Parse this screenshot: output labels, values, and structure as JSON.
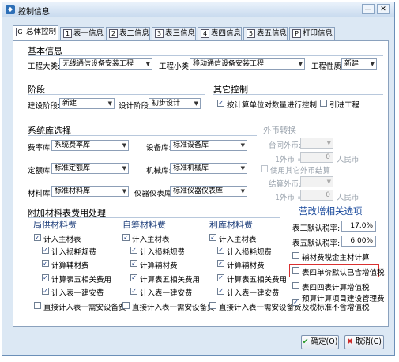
{
  "window": {
    "title": "控制信息",
    "min": "—",
    "close": "✕"
  },
  "tabs": [
    {
      "icon": "G",
      "label": "总体控制"
    },
    {
      "icon": "1",
      "label": "表一信息"
    },
    {
      "icon": "2",
      "label": "表二信息"
    },
    {
      "icon": "3",
      "label": "表三信息"
    },
    {
      "icon": "4",
      "label": "表四信息"
    },
    {
      "icon": "5",
      "label": "表五信息"
    },
    {
      "icon": "P",
      "label": "打印信息"
    }
  ],
  "basic": {
    "title": "基本信息",
    "project_category_label": "工程大类:",
    "project_category_value": "无线通信设备安装工程",
    "project_subcategory_label": "工程小类:",
    "project_subcategory_value": "移动通信设备安装工程",
    "project_nature_label": "工程性质:",
    "project_nature_value": "新建"
  },
  "stage": {
    "title": "阶段",
    "build_stage_label": "建设阶段:",
    "build_stage_value": "新建",
    "design_stage_label": "设计阶段:",
    "design_stage_value": "初步设计"
  },
  "other": {
    "title": "其它控制",
    "cb_mgmt": "按计算单位对数量进行控制",
    "cb_mgmt_checked": true,
    "cb_intro": "引进工程",
    "cb_intro_checked": false
  },
  "library": {
    "title": "系统库选择",
    "fee_label": "费率库:",
    "fee_value": "系统费率库",
    "equip_label": "设备库:",
    "equip_value": "标准设备库",
    "quota_label": "定额库:",
    "quota_value": "标准定额库",
    "machine_label": "机械库:",
    "machine_value": "标准机械库",
    "material_label": "材料库:",
    "material_value": "标准材料库",
    "meter_label": "仪器仪表库:",
    "meter_value": "标准仪器仪表库"
  },
  "foreign": {
    "title": "外币转换",
    "cb_label": "使用其它外币结算",
    "row1_label": "台同外币:",
    "row2_prefix": "1外币 =",
    "row2_value": "0",
    "row2_unit": "人民币",
    "row3_label": "结算外币:",
    "row4_prefix": "1外币 =",
    "row4_value": "0",
    "row4_unit": "人民币"
  },
  "materials": {
    "title": "附加材料表费用处理",
    "groups": [
      {
        "title": "局供材料费",
        "main": "计入主材表",
        "items": [
          "计入损耗规费",
          "计算辅材费",
          "计算表五相关费用",
          "计入表一建安费"
        ],
        "direct": "直接计入表一需安设备费"
      },
      {
        "title": "自筹材料费",
        "main": "计入主材表",
        "items": [
          "计入损耗规费",
          "计算辅材费",
          "计算表五相关费用",
          "计入表一建安费"
        ],
        "direct": "直接计入表一需安设备费"
      },
      {
        "title": "利库材料费",
        "main": "计入主材表",
        "items": [
          "计入损耗规费",
          "计算辅材费",
          "计算表五相关费用",
          "计入表一建安费"
        ],
        "direct": "直接计入表一需安设备费"
      }
    ]
  },
  "vat": {
    "title": "营改增相关选项",
    "rate3_label": "表三默认税率:",
    "rate3_value": "17.0%",
    "rate5_label": "表五默认税率:",
    "rate5_value": "6.00%",
    "cb1": "辅材费税金主材计算",
    "cb2": "表四单价默认已含增值税",
    "cb3": "表四四表计算增值税",
    "cb4_line1": "预算计算项目建设管理费",
    "cb4_line2": "及税标准不含增值税"
  },
  "buttons": {
    "ok": "确定(O)",
    "cancel": "取消(C)"
  }
}
